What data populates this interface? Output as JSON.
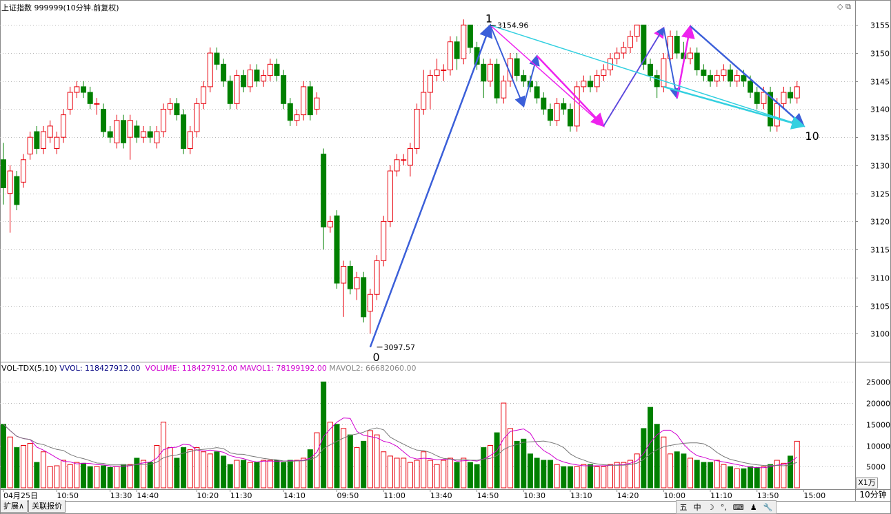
{
  "header": {
    "title": "上证指数 999999(10分钟.前复权)",
    "vol_indicator": "VOL-TDX(5,10)",
    "vvol_label": "VVOL: 118427912.00",
    "volume_label": "VOLUME: 118427912.00",
    "mavol1_label": "MAVOL1: 78199192.00",
    "mavol2_label": "MAVOL2: 66682060.00"
  },
  "colors": {
    "up": "#e8000b",
    "down": "#008000",
    "vvol_text": "#000080",
    "volume_text": "#d000d0",
    "mavol1_text": "#d000d0",
    "mavol2_text": "#888888",
    "wave_blue": "#3b5fd9",
    "wave_magenta": "#ee22ee",
    "wave_cyan": "#33d0e0",
    "grid": "#b8b8b8",
    "axis": "#888888"
  },
  "bottom_tabs": [
    "扩展∧",
    "关联报价"
  ],
  "ime_icons": [
    "五",
    "中",
    "moon-icon",
    "dots-icon",
    "keyboard-icon",
    "user-icon",
    "wrench-icon"
  ],
  "ime_labels": [
    "五",
    "中",
    "☽",
    "°,",
    "⌨",
    "♟",
    "🔧"
  ],
  "period_label": "10分钟",
  "volume_unit": "X1万",
  "window_icons": "◇ ⧉",
  "chart_data": {
    "type": "candlestick",
    "price_ylim": [
      3095,
      3157
    ],
    "price_ticks": [
      3100,
      3105,
      3110,
      3115,
      3120,
      3125,
      3130,
      3135,
      3140,
      3145,
      3150,
      3155
    ],
    "volume_ylim": [
      0,
      27000
    ],
    "volume_ticks": [
      5000,
      10000,
      15000,
      20000,
      25000
    ],
    "x_tick_labels": [
      {
        "i": 0,
        "label": "04月25日"
      },
      {
        "i": 8,
        "label": "10:50"
      },
      {
        "i": 16,
        "label": "13:30"
      },
      {
        "i": 20,
        "label": "14:40"
      },
      {
        "i": 29,
        "label": "10:20"
      },
      {
        "i": 34,
        "label": "11:30"
      },
      {
        "i": 42,
        "label": "14:10"
      },
      {
        "i": 50,
        "label": "09:50"
      },
      {
        "i": 57,
        "label": "11:00"
      },
      {
        "i": 64,
        "label": "13:40"
      },
      {
        "i": 71,
        "label": "14:50"
      },
      {
        "i": 78,
        "label": "10:30"
      },
      {
        "i": 85,
        "label": "13:10"
      },
      {
        "i": 92,
        "label": "14:20"
      },
      {
        "i": 99,
        "label": "10:00"
      },
      {
        "i": 106,
        "label": "11:10"
      },
      {
        "i": 113,
        "label": "13:50"
      },
      {
        "i": 120,
        "label": "15:00"
      }
    ],
    "candles": [
      [
        3131,
        3126,
        3134,
        3123
      ],
      [
        3125,
        3129,
        3130,
        3118
      ],
      [
        3128,
        3123,
        3129,
        3122
      ],
      [
        3127,
        3131,
        3132,
        3126
      ],
      [
        3132,
        3135,
        3136,
        3131
      ],
      [
        3136,
        3133,
        3137,
        3132
      ],
      [
        3133,
        3136,
        3137,
        3132
      ],
      [
        3135,
        3137,
        3138,
        3134
      ],
      [
        3133,
        3135,
        3136,
        3132
      ],
      [
        3135,
        3139,
        3140,
        3134
      ],
      [
        3140,
        3143,
        3144,
        3139
      ],
      [
        3143,
        3144,
        3145,
        3142
      ],
      [
        3144,
        3143,
        3145,
        3142
      ],
      [
        3143,
        3141,
        3144,
        3140
      ],
      [
        3141,
        3141,
        3142,
        3139
      ],
      [
        3140,
        3136,
        3141,
        3135
      ],
      [
        3136,
        3135,
        3137,
        3134
      ],
      [
        3134,
        3138,
        3139,
        3133
      ],
      [
        3138,
        3134,
        3139,
        3133
      ],
      [
        3135,
        3138,
        3139,
        3131
      ],
      [
        3137,
        3135,
        3138,
        3134
      ],
      [
        3135,
        3136,
        3137,
        3134
      ],
      [
        3136,
        3135,
        3137,
        3134
      ],
      [
        3134,
        3136,
        3137,
        3133
      ],
      [
        3136,
        3140,
        3141,
        3135
      ],
      [
        3140,
        3141,
        3142,
        3139
      ],
      [
        3141,
        3139,
        3142,
        3138
      ],
      [
        3139,
        3133,
        3140,
        3132
      ],
      [
        3133,
        3136,
        3137,
        3132
      ],
      [
        3136,
        3141,
        3142,
        3135
      ],
      [
        3141,
        3144,
        3145,
        3140
      ],
      [
        3144,
        3150,
        3151,
        3143
      ],
      [
        3150,
        3148,
        3151,
        3147
      ],
      [
        3148,
        3145,
        3149,
        3144
      ],
      [
        3145,
        3141,
        3146,
        3140
      ],
      [
        3141,
        3146,
        3147,
        3140
      ],
      [
        3146,
        3144,
        3147,
        3143
      ],
      [
        3144,
        3147,
        3148,
        3143
      ],
      [
        3147,
        3145,
        3148,
        3144
      ],
      [
        3145,
        3146,
        3147,
        3144
      ],
      [
        3146,
        3148,
        3149,
        3145
      ],
      [
        3148,
        3146,
        3149,
        3145
      ],
      [
        3146,
        3141,
        3147,
        3140
      ],
      [
        3141,
        3138,
        3142,
        3137
      ],
      [
        3138,
        3139,
        3140,
        3137
      ],
      [
        3139,
        3144,
        3145,
        3138
      ],
      [
        3144,
        3139,
        3145,
        3138
      ],
      [
        3140,
        3142,
        3143,
        3139
      ],
      [
        3132,
        3119,
        3133,
        3115
      ],
      [
        3119,
        3120,
        3121,
        3118
      ],
      [
        3121,
        3109,
        3122,
        3108
      ],
      [
        3109,
        3112,
        3113,
        3103
      ],
      [
        3112,
        3108,
        3113,
        3107
      ],
      [
        3108,
        3110,
        3111,
        3106
      ],
      [
        3110,
        3103,
        3111,
        3102
      ],
      [
        3104,
        3107,
        3108,
        3100
      ],
      [
        3107,
        3113,
        3114,
        3106
      ],
      [
        3113,
        3120,
        3121,
        3112
      ],
      [
        3120,
        3129,
        3130,
        3119
      ],
      [
        3129,
        3131,
        3132,
        3128
      ],
      [
        3131,
        3131,
        3132,
        3130
      ],
      [
        3130,
        3133,
        3134,
        3128
      ],
      [
        3133,
        3140,
        3141,
        3132
      ],
      [
        3140,
        3143,
        3147,
        3139
      ],
      [
        3143,
        3146,
        3147,
        3140
      ],
      [
        3146,
        3147,
        3149,
        3145
      ],
      [
        3147,
        3147,
        3148,
        3145
      ],
      [
        3147,
        3152,
        3153,
        3146
      ],
      [
        3152,
        3149,
        3153,
        3147
      ],
      [
        3149,
        3155,
        3156,
        3148
      ],
      [
        3155,
        3151,
        3155,
        3150
      ],
      [
        3151,
        3148,
        3152,
        3147
      ],
      [
        3148,
        3145,
        3149,
        3142
      ],
      [
        3145,
        3148,
        3149,
        3144
      ],
      [
        3148,
        3142,
        3149,
        3141
      ],
      [
        3142,
        3145,
        3146,
        3141
      ],
      [
        3145,
        3149,
        3150,
        3144
      ],
      [
        3149,
        3146,
        3150,
        3145
      ],
      [
        3146,
        3145,
        3147,
        3144
      ],
      [
        3145,
        3144,
        3146,
        3143
      ],
      [
        3144,
        3142,
        3145,
        3141
      ],
      [
        3142,
        3140,
        3143,
        3139
      ],
      [
        3140,
        3138,
        3141,
        3137
      ],
      [
        3138,
        3141,
        3142,
        3137
      ],
      [
        3141,
        3140,
        3142,
        3139
      ],
      [
        3140,
        3137,
        3141,
        3136
      ],
      [
        3137,
        3144,
        3145,
        3136
      ],
      [
        3144,
        3145,
        3146,
        3143
      ],
      [
        3145,
        3144,
        3146,
        3143
      ],
      [
        3144,
        3146,
        3147,
        3143
      ],
      [
        3146,
        3147,
        3148,
        3145
      ],
      [
        3147,
        3149,
        3150,
        3146
      ],
      [
        3149,
        3150,
        3151,
        3148
      ],
      [
        3150,
        3151,
        3152,
        3149
      ],
      [
        3151,
        3153,
        3154,
        3150
      ],
      [
        3153,
        3155,
        3155,
        3152
      ],
      [
        3155,
        3148,
        3155,
        3147
      ],
      [
        3148,
        3146,
        3149,
        3145
      ],
      [
        3146,
        3144,
        3147,
        3142
      ],
      [
        3144,
        3149,
        3150,
        3143
      ],
      [
        3149,
        3153,
        3154,
        3148
      ],
      [
        3153,
        3150,
        3154,
        3149
      ],
      [
        3150,
        3149,
        3152,
        3148
      ],
      [
        3149,
        3150,
        3151,
        3148
      ],
      [
        3150,
        3147,
        3151,
        3146
      ],
      [
        3147,
        3146,
        3148,
        3145
      ],
      [
        3146,
        3145,
        3147,
        3144
      ],
      [
        3145,
        3146,
        3147,
        3144
      ],
      [
        3146,
        3147,
        3148,
        3145
      ],
      [
        3147,
        3145,
        3148,
        3144
      ],
      [
        3145,
        3146,
        3147,
        3144
      ],
      [
        3146,
        3145,
        3147,
        3144
      ],
      [
        3145,
        3143,
        3146,
        3142
      ],
      [
        3143,
        3141,
        3144,
        3140
      ],
      [
        3141,
        3143,
        3144,
        3140
      ],
      [
        3143,
        3137,
        3144,
        3136
      ],
      [
        3137,
        3141,
        3142,
        3136
      ],
      [
        3141,
        3143,
        3144,
        3140
      ],
      [
        3143,
        3142,
        3144,
        3141
      ],
      [
        3142,
        3144,
        3145,
        3141
      ]
    ],
    "volume": [
      15000,
      12000,
      9500,
      10000,
      10500,
      6000,
      8500,
      5000,
      5200,
      6500,
      5500,
      6000,
      5800,
      5000,
      5000,
      5200,
      4800,
      5000,
      5500,
      5500,
      7000,
      6500,
      6000,
      10000,
      15500,
      9500,
      7000,
      9500,
      9000,
      9500,
      8500,
      8000,
      8500,
      7500,
      5500,
      6500,
      6500,
      6000,
      6000,
      6500,
      6500,
      6500,
      6000,
      6500,
      6500,
      7000,
      9000,
      13000,
      25000,
      15500,
      15000,
      14000,
      12500,
      9500,
      11000,
      13500,
      12500,
      8500,
      7500,
      7000,
      7000,
      6000,
      6500,
      8500,
      6500,
      5500,
      6500,
      7000,
      6000,
      7000,
      6000,
      5500,
      9500,
      10000,
      13000,
      20000,
      14000,
      11000,
      11500,
      8000,
      7000,
      6500,
      6500,
      5500,
      5000,
      5000,
      5000,
      5500,
      5500,
      5000,
      5000,
      5500,
      6000,
      6000,
      6500,
      8000,
      14000,
      19000,
      15000,
      12000,
      8000,
      8500,
      8000,
      7000,
      6500,
      6000,
      6000,
      6500,
      5500,
      5000,
      4500,
      4500,
      5000,
      4800,
      5000,
      5500,
      6500,
      5800,
      7500,
      11000
    ],
    "annotations": {
      "low_price": "3097.57",
      "high_price": "3154.96",
      "wave_labels": [
        "0",
        "1",
        "10"
      ]
    }
  }
}
